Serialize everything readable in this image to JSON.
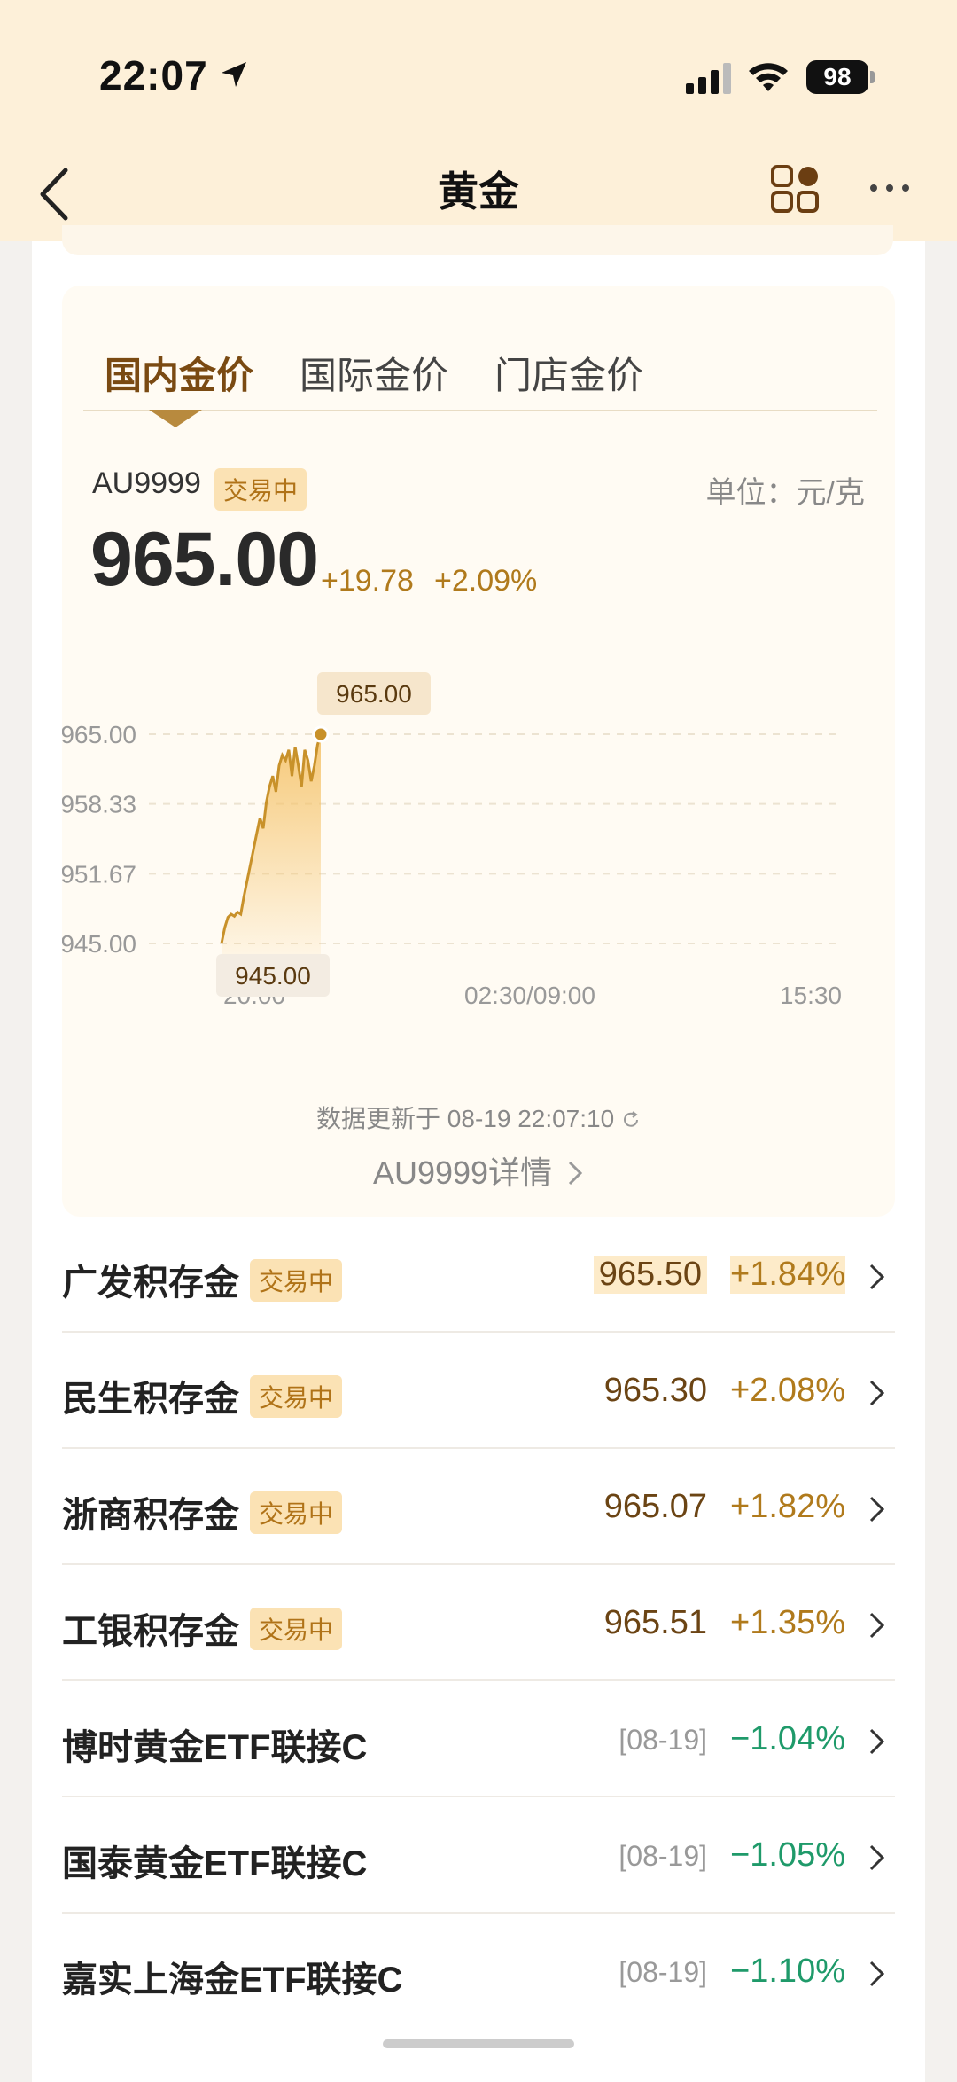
{
  "status": {
    "time": "22:07",
    "battery": "98"
  },
  "nav": {
    "title": "黄金"
  },
  "tabs": [
    {
      "label": "国内金价"
    },
    {
      "label": "国际金价"
    },
    {
      "label": "门店金价"
    }
  ],
  "quote": {
    "symbol": "AU9999",
    "status_badge": "交易中",
    "unit": "单位：元/克",
    "price": "965.00",
    "change": "+19.78",
    "change_pct": "+2.09%",
    "update_text": "数据更新于 08-19 22:07:10",
    "detail_link": "AU9999详情"
  },
  "chart_data": {
    "type": "line",
    "y_ticks": [
      "965.00",
      "958.33",
      "951.67",
      "945.00"
    ],
    "x_ticks": [
      "20:00",
      "02:30/09:00",
      "15:30"
    ],
    "ylim": [
      945.0,
      965.0
    ],
    "max_label": "965.00",
    "min_label": "945.00",
    "series": [
      {
        "values": [
          945.0,
          946.5,
          947.5,
          947.8,
          947.6,
          948.0,
          947.8,
          949.5,
          951.0,
          952.5,
          954.0,
          955.5,
          957.0,
          956.0,
          958.5,
          960.0,
          961.0,
          959.5,
          962.0,
          963.0,
          962.5,
          963.5,
          961.0,
          963.8,
          962.0,
          960.0,
          963.5,
          962.5,
          960.5,
          962.0,
          964.0,
          965.0
        ]
      }
    ],
    "colors": {
      "line": "#c8912a",
      "fill": "#f5c36a"
    }
  },
  "products": [
    {
      "name": "广发积存金",
      "badge": "交易中",
      "price": "965.50",
      "change": "+1.84%",
      "dir": "up",
      "highlight": true
    },
    {
      "name": "民生积存金",
      "badge": "交易中",
      "price": "965.30",
      "change": "+2.08%",
      "dir": "up"
    },
    {
      "name": "浙商积存金",
      "badge": "交易中",
      "price": "965.07",
      "change": "+1.82%",
      "dir": "up"
    },
    {
      "name": "工银积存金",
      "badge": "交易中",
      "price": "965.51",
      "change": "+1.35%",
      "dir": "up"
    },
    {
      "name": "博时黄金ETF联接C",
      "date": "[08-19]",
      "change": "−1.04%",
      "dir": "down"
    },
    {
      "name": "国泰黄金ETF联接C",
      "date": "[08-19]",
      "change": "−1.05%",
      "dir": "down"
    },
    {
      "name": "嘉实上海金ETF联接C",
      "date": "[08-19]",
      "change": "−1.10%",
      "dir": "down"
    }
  ]
}
